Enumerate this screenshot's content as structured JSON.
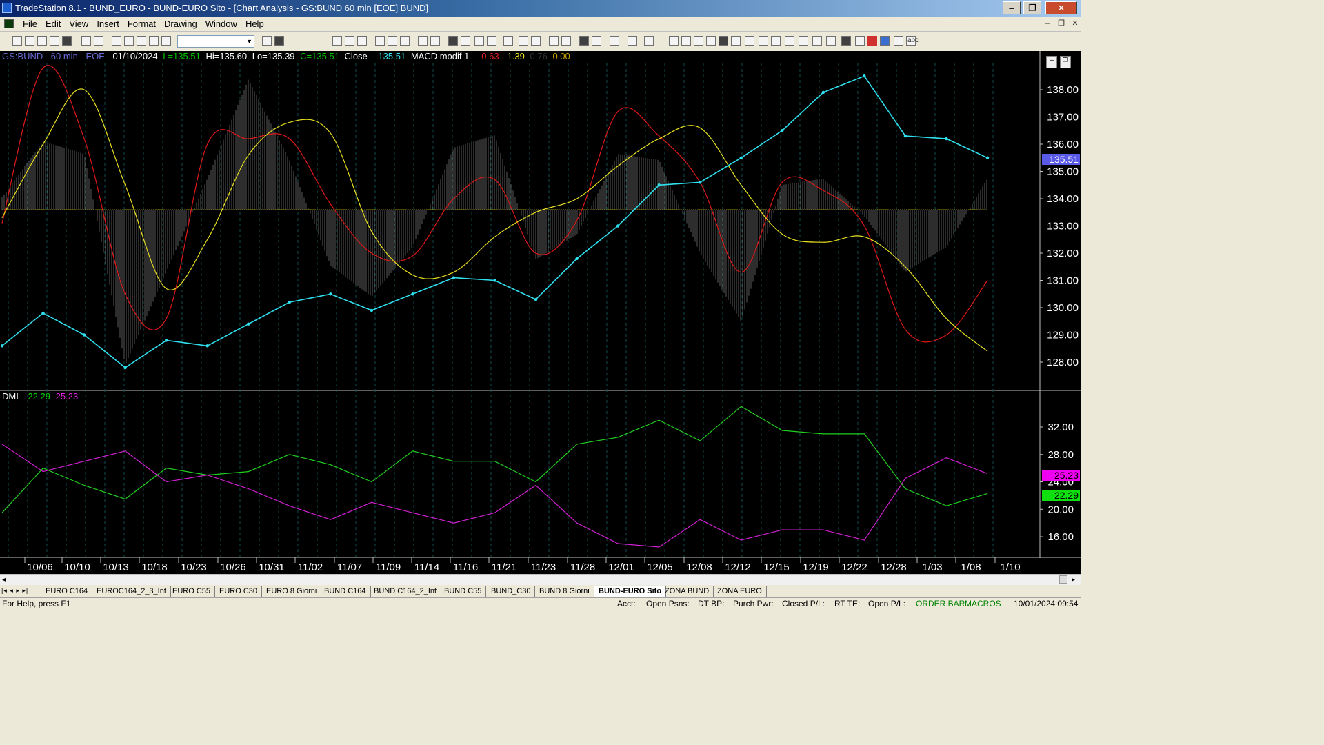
{
  "window": {
    "title": "TradeStation 8.1 - BUND_EURO - BUND-EURO Sito - [Chart Analysis - GS:BUND  60 min  [EOE] BUND]",
    "minimize": "‒",
    "maximize": "❐",
    "close": "✕"
  },
  "menu": [
    "File",
    "Edit",
    "View",
    "Insert",
    "Format",
    "Drawing",
    "Window",
    "Help"
  ],
  "mdi": {
    "minimize": "–",
    "restore": "❐",
    "close": "✕"
  },
  "header": {
    "symbol": "GS:BUND - 60 min",
    "session": "EOE",
    "date": "01/10/2024",
    "last": "L=135.51",
    "high": "Hi=135.60",
    "low": "Lo=135.39",
    "close": "C=135.51",
    "close_label": "Close",
    "close_value": "135.51",
    "macd_label": "MACD modif 1",
    "macd_v1": "-0.63",
    "macd_v2": "-1.39",
    "macd_v3": "0.76",
    "macd_v4": "0.00"
  },
  "dmi": {
    "label": "DMI",
    "plus": "22.29",
    "minus": "25.23"
  },
  "price_axis": {
    "ticks": [
      "138.00",
      "137.00",
      "136.00",
      "135.00",
      "134.00",
      "133.00",
      "132.00",
      "131.00",
      "130.00",
      "129.00",
      "128.00"
    ],
    "current": "135.51"
  },
  "dmi_axis": {
    "ticks": [
      "32.00",
      "28.00",
      "24.00",
      "20.00",
      "16.00"
    ],
    "minus_value": "25.23",
    "plus_value": "22.29"
  },
  "date_axis": [
    "10/06",
    "10/10",
    "10/13",
    "10/18",
    "10/23",
    "10/26",
    "10/31",
    "11/02",
    "11/07",
    "11/09",
    "11/14",
    "11/16",
    "11/21",
    "11/23",
    "11/28",
    "12/01",
    "12/05",
    "12/08",
    "12/12",
    "12/15",
    "12/19",
    "12/22",
    "12/28",
    "1/03",
    "1/08",
    "1/10"
  ],
  "chart_data": [
    {
      "type": "line",
      "title": "GS:BUND - 60 min",
      "ylim": [
        127.5,
        139
      ],
      "categories": [
        "10/06",
        "10/10",
        "10/13",
        "10/18",
        "10/23",
        "10/26",
        "10/31",
        "11/02",
        "11/07",
        "11/09",
        "11/14",
        "11/16",
        "11/21",
        "11/23",
        "11/28",
        "12/01",
        "12/05",
        "12/08",
        "12/12",
        "12/15",
        "12/19",
        "12/22",
        "12/28",
        "1/03",
        "1/08"
      ],
      "series": [
        {
          "name": "Close",
          "values": [
            128.6,
            129.8,
            129.0,
            127.8,
            128.8,
            128.6,
            129.4,
            130.2,
            130.5,
            129.9,
            130.5,
            131.1,
            131.0,
            130.3,
            131.8,
            133.0,
            134.5,
            134.6,
            135.5,
            136.5,
            137.9,
            138.5,
            136.3,
            136.2,
            135.5
          ]
        },
        {
          "values": [
            133.1,
            138.8,
            136.2,
            130.5,
            129.6,
            136.0,
            136.2,
            136.2,
            133.8,
            132.0,
            131.9,
            134.0,
            134.7,
            132.0,
            133.2,
            137.2,
            136.3,
            134.6,
            131.3,
            134.6,
            134.3,
            133.0,
            129.2,
            129.0,
            131.0
          ]
        },
        {
          "values": [
            133.3,
            136.0,
            138.0,
            134.5,
            130.7,
            132.5,
            135.6,
            136.8,
            136.4,
            132.8,
            131.2,
            131.3,
            132.6,
            133.5,
            134.0,
            135.2,
            136.2,
            136.6,
            134.5,
            132.7,
            132.4,
            132.6,
            131.5,
            129.6,
            128.4
          ]
        }
      ],
      "histogram": {
        "values": [
          0.2,
          1.1,
          0.9,
          -2.5,
          -1.0,
          0.5,
          2.1,
          0.8,
          -0.9,
          -1.4,
          -0.6,
          1.0,
          1.2,
          -0.8,
          -0.4,
          0.9,
          0.8,
          -0.7,
          -1.8,
          0.4,
          0.5,
          -0.1,
          -1.0,
          -0.6,
          0.5
        ],
        "zero_line": true
      }
    },
    {
      "type": "line",
      "title": "DMI",
      "ylim": [
        14,
        35
      ],
      "categories": [
        "10/06",
        "10/10",
        "10/13",
        "10/18",
        "10/23",
        "10/26",
        "10/31",
        "11/02",
        "11/07",
        "11/09",
        "11/14",
        "11/16",
        "11/21",
        "11/23",
        "11/28",
        "12/01",
        "12/05",
        "12/08",
        "12/12",
        "12/15",
        "12/19",
        "12/22",
        "12/28",
        "1/03",
        "1/08"
      ],
      "series": [
        {
          "name": "22.29",
          "values": [
            19.5,
            26.0,
            23.5,
            21.5,
            26.0,
            25.0,
            25.5,
            28.0,
            26.5,
            24.0,
            28.5,
            27.0,
            27.0,
            24.0,
            29.5,
            30.5,
            33.0,
            30.0,
            35.0,
            31.5,
            31.0,
            31.0,
            23.0,
            20.5,
            22.3
          ]
        },
        {
          "name": "25.23",
          "values": [
            29.5,
            25.5,
            27.0,
            28.5,
            24.0,
            25.0,
            23.0,
            20.5,
            18.5,
            21.0,
            19.5,
            18.0,
            19.5,
            23.5,
            18.0,
            15.0,
            14.5,
            18.5,
            15.5,
            17.0,
            17.0,
            15.5,
            24.5,
            27.5,
            25.2
          ]
        }
      ]
    }
  ],
  "tabs": [
    "EURO C164",
    "EUROC164_2_3_Int",
    "EURO C55",
    "EURO C30",
    "EURO 8 Giorni",
    "BUND C164",
    "BUND C164_2_Int",
    "BUND C55",
    "BUND_C30",
    "BUND 8 Giorni",
    "BUND-EURO Sito",
    "ZONA BUND",
    "ZONA EURO"
  ],
  "active_tab": "BUND-EURO Sito",
  "status": {
    "help": "For Help, press F1",
    "acct": "Acct:",
    "open_psns": "Open Psns:",
    "dt_bp": "DT BP:",
    "purch_pwr": "Purch Pwr:",
    "closed_pl": "Closed P/L:",
    "rt_te": "RT TE:",
    "open_pl": "Open P/L:",
    "order_bar": "ORDER BAR",
    "macros": "MACROS",
    "datetime": "10/01/2024 09:54"
  }
}
